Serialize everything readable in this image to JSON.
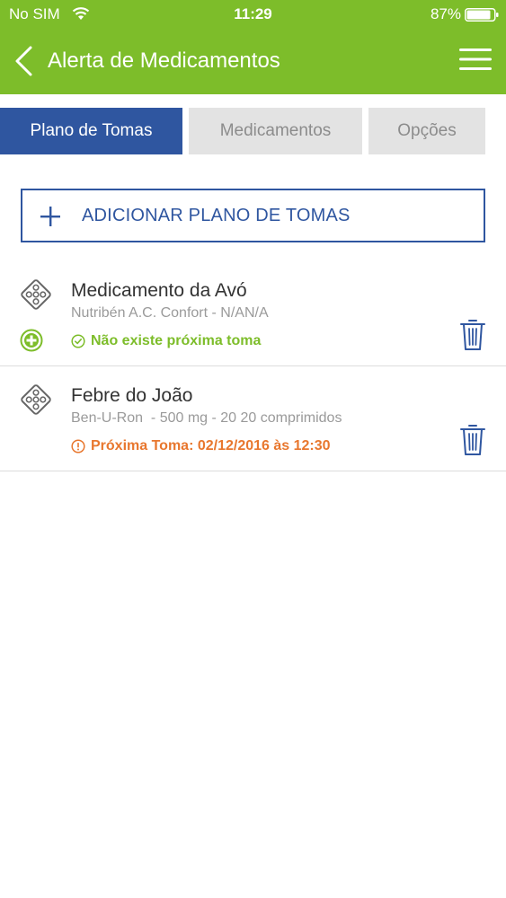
{
  "status_bar": {
    "carrier": "No SIM",
    "time": "11:29",
    "battery": "87%"
  },
  "nav": {
    "title": "Alerta de Medicamentos",
    "back_icon": "chevron-left-icon",
    "menu_icon": "hamburger-menu-icon"
  },
  "tabs": [
    {
      "label": "Plano de Tomas",
      "active": true
    },
    {
      "label": "Medicamentos",
      "active": false
    },
    {
      "label": "Opções",
      "active": false
    }
  ],
  "add_button": {
    "label": "ADICIONAR PLANO DE TOMAS",
    "icon": "plus-icon"
  },
  "plans": [
    {
      "title": "Medicamento da Avó",
      "subtitle": "Nutribén A.C. Confort - N/AN/A",
      "status": "Não existe próxima toma",
      "status_type": "ok",
      "icon": "pill-blister-icon"
    },
    {
      "title": "Febre do João",
      "subtitle": "Ben-U-Ron  - 500 mg - 20 20 comprimidos",
      "status": "Próxima Toma: 02/12/2016 às 12:30",
      "status_type": "warning",
      "icon": "pill-blister-icon"
    }
  ],
  "colors": {
    "header_green": "#7dbd2a",
    "primary_blue": "#2f56a0",
    "ok_green": "#7dbd2a",
    "warning_orange": "#e8772e"
  }
}
